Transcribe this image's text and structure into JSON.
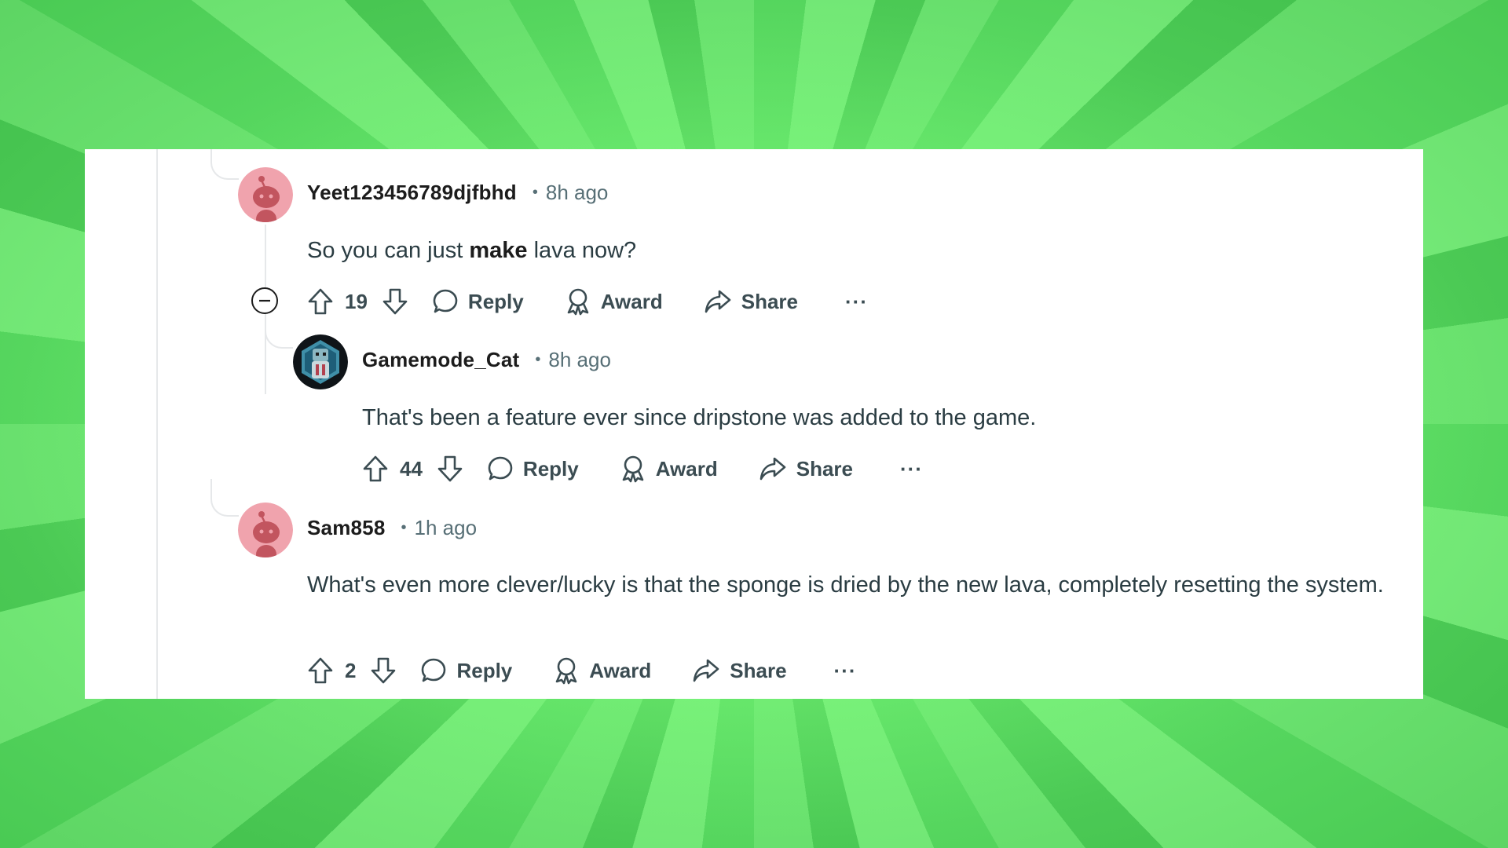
{
  "comments": [
    {
      "username": "Yeet123456789djfbhd",
      "time": "8h ago",
      "text_before": "So you can just ",
      "text_bold": "make",
      "text_after": " lava now?",
      "score": "19",
      "reply_label": "Reply",
      "award_label": "Award",
      "share_label": "Share",
      "more_label": "···"
    },
    {
      "username": "Gamemode_Cat",
      "time": "8h ago",
      "text": "That's been a feature ever since dripstone was added to the game.",
      "score": "44",
      "reply_label": "Reply",
      "award_label": "Award",
      "share_label": "Share",
      "more_label": "···"
    },
    {
      "username": "Sam858",
      "time": "1h ago",
      "text": "What's even more clever/lucky is that the sponge is dried by the new lava, completely resetting the system.",
      "score": "2",
      "reply_label": "Reply",
      "award_label": "Award",
      "share_label": "Share",
      "more_label": "···"
    }
  ],
  "colors": {
    "background": "#6fe674",
    "card": "#ffffff",
    "avatar_pink": "#f0a3ad",
    "text": "#2a3c42",
    "meta": "#576f76"
  }
}
